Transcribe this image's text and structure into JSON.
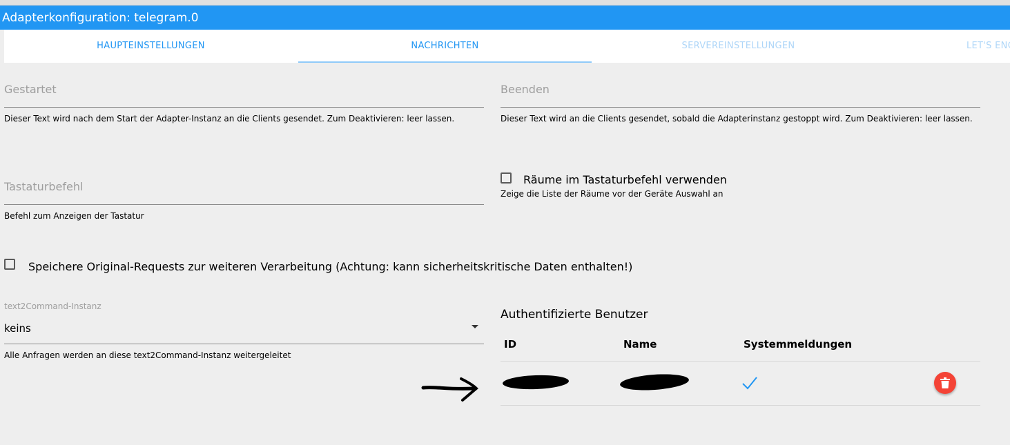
{
  "window": {
    "title": "Adapterkonfiguration: telegram.0"
  },
  "tabs": [
    {
      "label": "HAUPTEINSTELLUNGEN"
    },
    {
      "label": "NACHRICHTEN"
    },
    {
      "label": "SERVEREINSTELLUNGEN"
    },
    {
      "label": "LET'S ENC"
    }
  ],
  "form": {
    "started": {
      "placeholder": "Gestartet",
      "help": "Dieser Text wird nach dem Start der Adapter-Instanz an die Clients gesendet. Zum Deaktivieren: leer lassen."
    },
    "stop": {
      "placeholder": "Beenden",
      "help": "Dieser Text wird an die Clients gesendet, sobald die Adapterinstanz gestoppt wird. Zum Deaktivieren: leer lassen."
    },
    "keyboard": {
      "placeholder": "Tastaturbefehl",
      "help": "Befehl zum Anzeigen der Tastatur"
    },
    "rooms": {
      "label": "Räume im Tastaturbefehl verwenden",
      "help": "Zeige die Liste der Räume vor der Geräte Auswahl an",
      "checked": false
    },
    "store_raw": {
      "label": "Speichere Original-Requests zur weiteren Verarbeitung (Achtung: kann sicherheitskritische Daten enthalten!)",
      "checked": false
    },
    "text2command": {
      "label": "text2Command-Instanz",
      "value": "keins",
      "help": "Alle Anfragen werden an diese text2Command-Instanz weitergeleitet"
    }
  },
  "users": {
    "title": "Authentifizierte Benutzer",
    "columns": [
      "ID",
      "Name",
      "Systemmeldungen"
    ],
    "rows": [
      {
        "id": "",
        "name": "",
        "system_messages": true
      }
    ]
  },
  "colors": {
    "accent": "#2196f3",
    "delete": "#f44336",
    "background": "#eeeeee"
  }
}
